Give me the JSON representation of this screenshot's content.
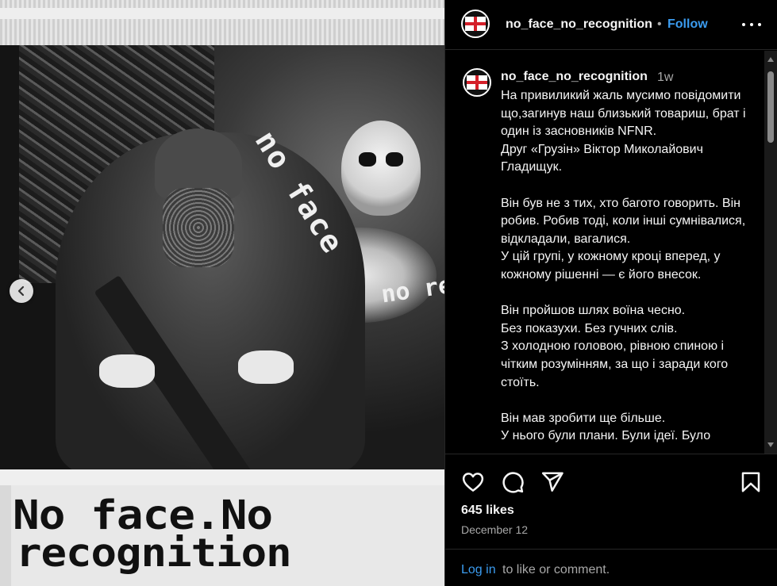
{
  "media": {
    "image_text_1": "no face",
    "image_text_2": "no rec",
    "caption_line1": "No face.No",
    "caption_line2": "recognition",
    "prev_icon": "chevron-left-icon"
  },
  "header": {
    "username": "no_face_no_recognition",
    "separator": "•",
    "follow_label": "Follow",
    "more_icon": "more-horizontal-icon"
  },
  "caption": {
    "username": "no_face_no_recognition",
    "time": "1w",
    "text": "На привиликий жаль мусимо повідомити що,загинув наш близький товариш, брат і один із засновників NFNR.\nДруг «Грузін» Віктор Миколайович Гладищук.\n\nВін був не з тих, хто багото говорить. Він робив. Робив тоді, коли інші сумнівалися, відкладали, вагалися.\nУ цій групі, у кожному кроці вперед, у кожному рішенні — є його внесок.\n\nВін пройшов шлях воїна чесно.\nБез показухи. Без гучних слів.\nЗ холодною головою, рівною спиною і чітким розумінням, за що і заради кого стоїть.\n\nВін мав зробити ще більше.\nУ нього були плани. Були ідеї. Було"
  },
  "actions": {
    "like_icon": "heart-icon",
    "comment_icon": "comment-icon",
    "share_icon": "share-icon",
    "save_icon": "bookmark-icon",
    "likes": "645 likes",
    "date": "December 12"
  },
  "footer": {
    "login_link": "Log in",
    "login_rest": "to like or comment."
  },
  "colors": {
    "link": "#3b9cf0",
    "background": "#000000",
    "muted": "#a8a8a8",
    "flag_red": "#d4202a"
  }
}
